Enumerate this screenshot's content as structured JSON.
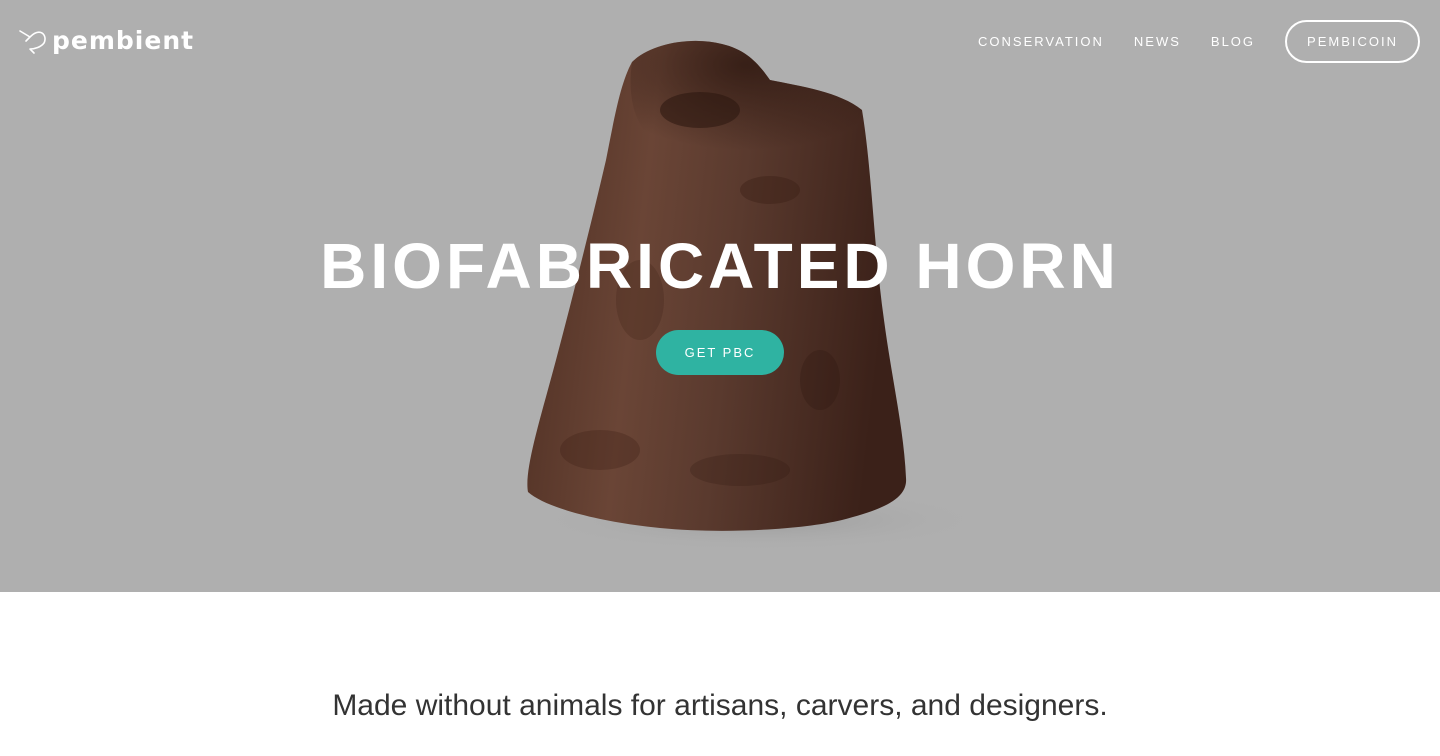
{
  "brand": {
    "name": "pembient",
    "logo_icon": "bird-logo-icon"
  },
  "nav": {
    "links": [
      {
        "label": "CONSERVATION"
      },
      {
        "label": "NEWS"
      },
      {
        "label": "BLOG"
      }
    ],
    "cta_label": "PEMBICOIN"
  },
  "hero": {
    "title": "BIOFABRICATED HORN",
    "button_label": "GET PBC",
    "image_icon": "horn-photo",
    "background_color": "#afafaf",
    "button_color": "#2fb3a2"
  },
  "content": {
    "tagline": "Made without animals for artisans, carvers, and designers."
  }
}
